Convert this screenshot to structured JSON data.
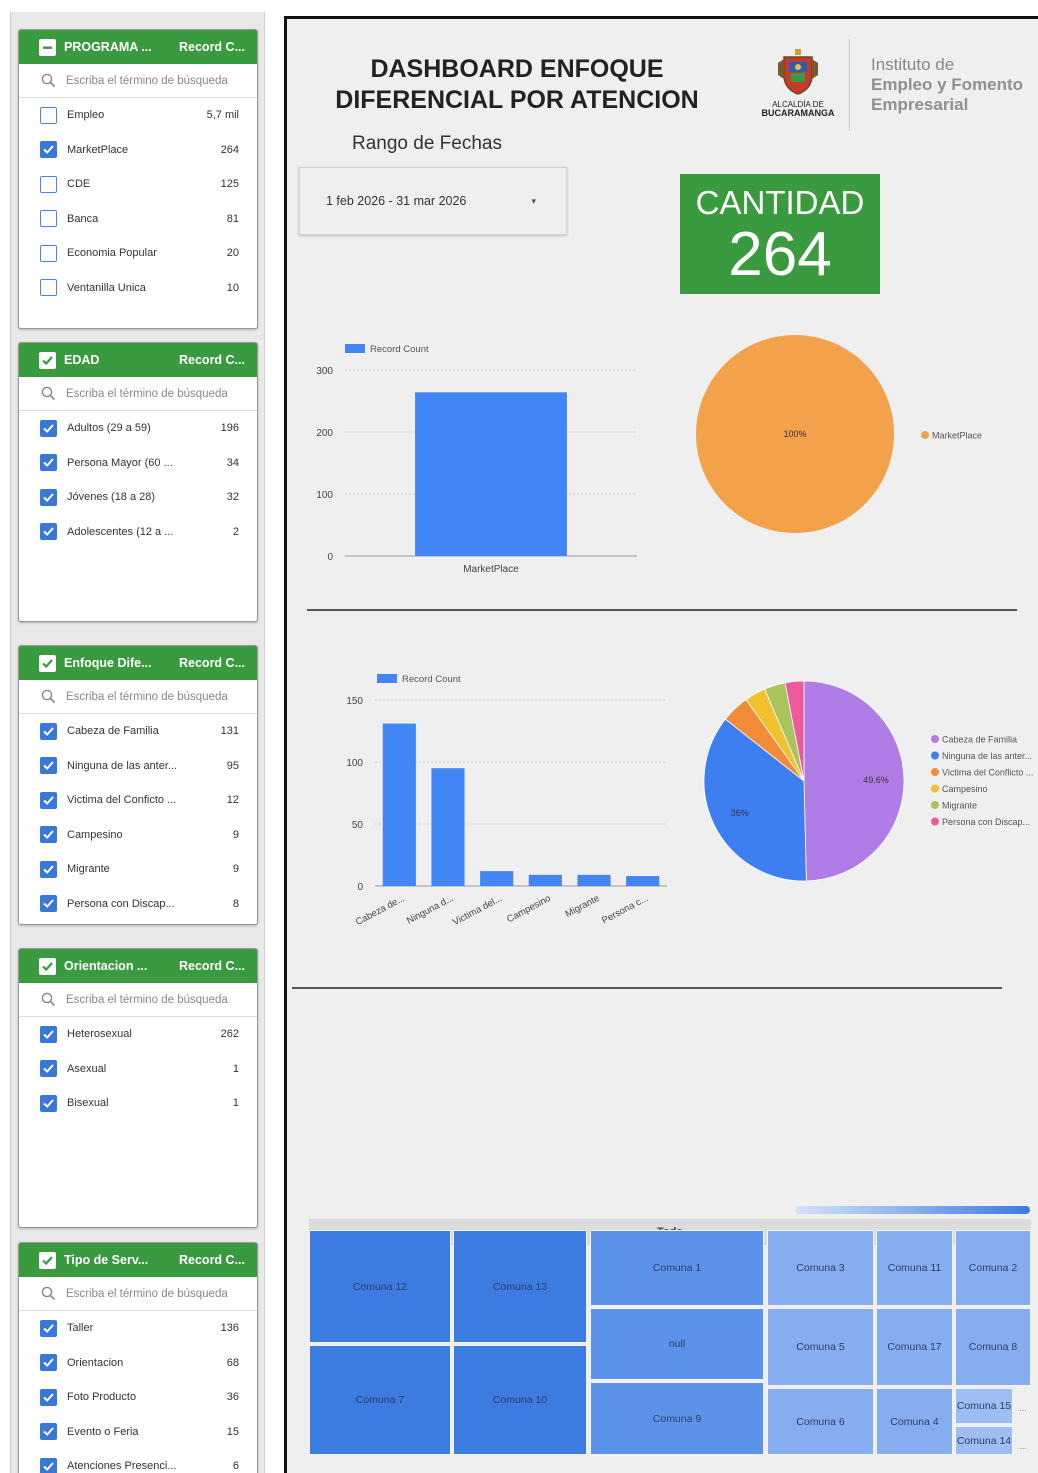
{
  "filters": [
    {
      "name": "PROGRAMA ...",
      "metric": "Record C...",
      "head_state": "partial",
      "search_placeholder": "Escriba el término de búsqueda",
      "items": [
        {
          "label": "Empleo",
          "count": "5,7 mil",
          "checked": false
        },
        {
          "label": "MarketPlace",
          "count": "264",
          "checked": true
        },
        {
          "label": "CDE",
          "count": "125",
          "checked": false
        },
        {
          "label": "Banca",
          "count": "81",
          "checked": false
        },
        {
          "label": "Economia Popular",
          "count": "20",
          "checked": false
        },
        {
          "label": "Ventanilla Unica",
          "count": "10",
          "checked": false
        }
      ]
    },
    {
      "name": "EDAD",
      "metric": "Record C...",
      "head_state": "checked",
      "search_placeholder": "Escriba el término de búsqueda",
      "items": [
        {
          "label": "Adultos (29 a 59)",
          "count": "196",
          "checked": true
        },
        {
          "label": "Persona Mayor (60 ...",
          "count": "34",
          "checked": true
        },
        {
          "label": "Jóvenes (18 a 28)",
          "count": "32",
          "checked": true
        },
        {
          "label": "Adolescentes (12 a ...",
          "count": "2",
          "checked": true
        }
      ]
    },
    {
      "name": "Enfoque Dife...",
      "metric": "Record C...",
      "head_state": "checked",
      "search_placeholder": "Escriba el término de búsqueda",
      "items": [
        {
          "label": "Cabeza de Familia",
          "count": "131",
          "checked": true
        },
        {
          "label": "Ninguna de las anter...",
          "count": "95",
          "checked": true
        },
        {
          "label": "Victima del Conficto ...",
          "count": "12",
          "checked": true
        },
        {
          "label": "Campesino",
          "count": "9",
          "checked": true
        },
        {
          "label": "Migrante",
          "count": "9",
          "checked": true
        },
        {
          "label": "Persona con Discap...",
          "count": "8",
          "checked": true
        }
      ]
    },
    {
      "name": "Orientacion ...",
      "metric": "Record C...",
      "head_state": "checked",
      "search_placeholder": "Escriba el término de búsqueda",
      "items": [
        {
          "label": "Heterosexual",
          "count": "262",
          "checked": true
        },
        {
          "label": "Asexual",
          "count": "1",
          "checked": true
        },
        {
          "label": "Bisexual",
          "count": "1",
          "checked": true
        }
      ]
    },
    {
      "name": "Tipo de Serv...",
      "metric": "Record C...",
      "head_state": "checked",
      "search_placeholder": "Escriba el término de búsqueda",
      "items": [
        {
          "label": "Taller",
          "count": "136",
          "checked": true
        },
        {
          "label": "Orientacion",
          "count": "68",
          "checked": true
        },
        {
          "label": "Foto Producto",
          "count": "36",
          "checked": true
        },
        {
          "label": "Evento o Feria",
          "count": "15",
          "checked": true
        },
        {
          "label": "Atenciones Presenci...",
          "count": "6",
          "checked": true
        }
      ]
    }
  ],
  "header": {
    "title_line1": "DASHBOARD ENFOQUE",
    "title_line2": "DIFERENCIAL POR ATENCION",
    "crest_caption1": "ALCALDÍA DE",
    "crest_caption2": "BUCARAMANGA",
    "institute_line1": "Instituto de",
    "institute_line2": "Empleo y Fomento",
    "institute_line3": "Empresarial"
  },
  "date_range": {
    "label": "Rango de Fechas",
    "value": "1 feb 2026 - 31 mar 2026"
  },
  "kpi": {
    "label": "CANTIDAD",
    "value": "264"
  },
  "colors": {
    "green": "#3a9a3f",
    "bar_blue": "#4285f4",
    "orange": "#f4a14c"
  },
  "chart_data": [
    {
      "type": "bar",
      "legend": "Record Count",
      "categories": [
        "MarketPlace"
      ],
      "values": [
        264
      ],
      "ylim": [
        0,
        300
      ],
      "yticks": [
        0,
        100,
        200,
        300
      ]
    },
    {
      "type": "pie",
      "labels": [
        "MarketPlace"
      ],
      "values": [
        264
      ],
      "slice_labels": [
        "100%"
      ],
      "colors": [
        "#f4a14c"
      ],
      "legend_position": "right"
    },
    {
      "type": "bar",
      "legend": "Record Count",
      "categories": [
        "Cabeza de...",
        "Ninguna d...",
        "Victima del...",
        "Campesino",
        "Migrante",
        "Persona c..."
      ],
      "values": [
        131,
        95,
        12,
        9,
        9,
        8
      ],
      "ylim": [
        0,
        150
      ],
      "yticks": [
        0,
        50,
        100,
        150
      ]
    },
    {
      "type": "pie",
      "labels": [
        "Cabeza de Familia",
        "Ninguna de las anter...",
        "Victima del Conflicto ...",
        "Campesino",
        "Migrante",
        "Persona con Discap..."
      ],
      "values": [
        131,
        95,
        12,
        9,
        9,
        8
      ],
      "slice_labels": [
        "49.6%",
        "36%",
        "",
        "",
        "",
        ""
      ],
      "colors": [
        "#b07de6",
        "#3d7ff0",
        "#f28c38",
        "#f2c12e",
        "#a9c45a",
        "#ee5a9e"
      ],
      "legend_position": "right"
    }
  ],
  "treemap": {
    "header": "Todo",
    "cells": [
      "Comuna 12",
      "Comuna 7",
      "Comuna 13",
      "Comuna 10",
      "Comuna 1",
      "null",
      "Comuna 9",
      "Comuna 3",
      "Comuna 5",
      "Comuna 6",
      "Comuna 11",
      "Comuna 17",
      "Comuna 4",
      "Comuna 2",
      "Comuna 8",
      "Comuna 15",
      "Comuna 14"
    ],
    "more": "..."
  }
}
